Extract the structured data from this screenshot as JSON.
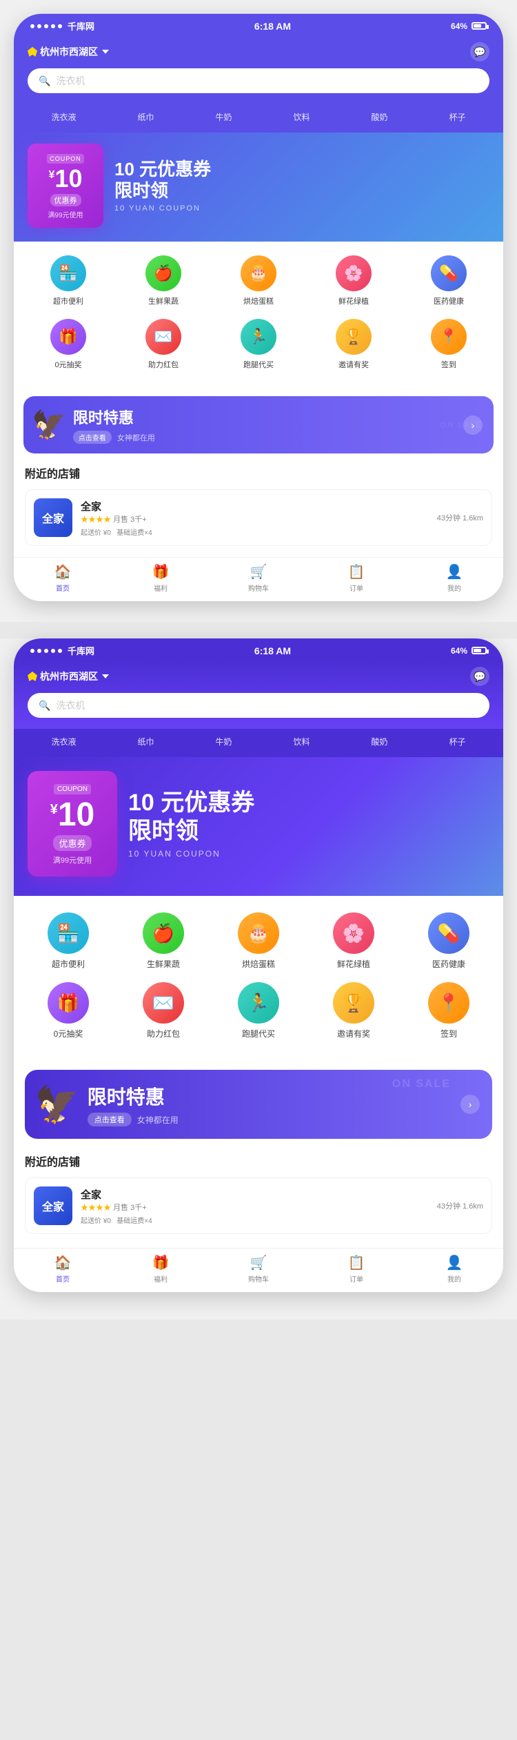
{
  "app": {
    "name": "千库网",
    "status_time": "6:18 AM",
    "battery": "64%"
  },
  "header": {
    "location": "杭州市西湖区",
    "search_placeholder": "洗衣机",
    "msg_icon": "💬"
  },
  "cat_tabs": [
    "洗衣液",
    "纸巾",
    "牛奶",
    "饮料",
    "酸奶",
    "杯子"
  ],
  "banner": {
    "coupon_label": "COUPON",
    "coupon_yuan": "¥",
    "coupon_amount": "10",
    "coupon_type": "优惠券",
    "coupon_condition": "满99元使用",
    "title_line1": "10 元优惠券",
    "title_line2": "限时领",
    "subtitle": "10 YUAN COUPON"
  },
  "icon_grid": {
    "row1": [
      {
        "label": "超市便利",
        "emoji": "🏪",
        "color_class": "ic-cyan"
      },
      {
        "label": "生鲜果蔬",
        "emoji": "🍎",
        "color_class": "ic-green"
      },
      {
        "label": "烘焙蛋糕",
        "emoji": "🎂",
        "color_class": "ic-orange"
      },
      {
        "label": "鲜花绿植",
        "emoji": "🌸",
        "color_class": "ic-pink"
      },
      {
        "label": "医药健康",
        "emoji": "💊",
        "color_class": "ic-blue"
      }
    ],
    "row2": [
      {
        "label": "0元抽奖",
        "emoji": "🎁",
        "color_class": "ic-purple"
      },
      {
        "label": "助力红包",
        "emoji": "✉️",
        "color_class": "ic-red"
      },
      {
        "label": "跑腿代买",
        "emoji": "🏃",
        "color_class": "ic-teal"
      },
      {
        "label": "邀请有奖",
        "emoji": "🏆",
        "color_class": "ic-gold"
      },
      {
        "label": "签到",
        "emoji": "📍",
        "color_class": "ic-orange"
      }
    ]
  },
  "promo": {
    "mascot": "🦅",
    "title": "限时特惠",
    "sale_text": "ON SALE",
    "btn_label": "点击查看",
    "sub_label": "女神都在用",
    "arrow": "›"
  },
  "nearby": {
    "section_title": "附近的店铺",
    "store": {
      "logo_text": "全家",
      "name": "全家",
      "stars": "★★★★",
      "monthly": "月售 3千+",
      "start_price": "起送价 ¥0",
      "base_fee": "基础运费×4",
      "distance": "43分钟 1.6km"
    }
  },
  "bottom_nav": [
    {
      "label": "首页",
      "emoji": "🏠",
      "active": true
    },
    {
      "label": "福利",
      "emoji": "🎁",
      "active": false
    },
    {
      "label": "购物车",
      "emoji": "🛒",
      "active": false
    },
    {
      "label": "订单",
      "emoji": "📋",
      "active": false
    },
    {
      "label": "我的",
      "emoji": "👤",
      "active": false
    }
  ]
}
